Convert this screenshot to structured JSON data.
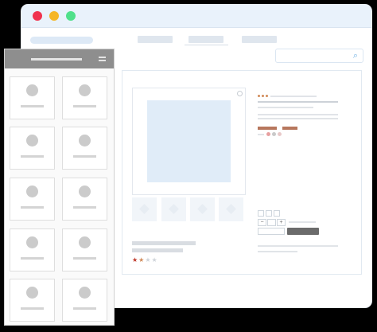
{
  "browser": {
    "traffic_lights": {
      "close": "#f0334f",
      "minimize": "#f5b625",
      "maximize": "#4fe08a"
    },
    "search": {
      "icon": "search-icon"
    },
    "colors": {
      "titlebar": "#e9f2fb",
      "accent": "#b7775d",
      "image": "#e0ecf8"
    }
  },
  "product": {
    "rating": {
      "filled": 2,
      "total": 4
    },
    "swatch_colors": [
      "#e7a0a0",
      "#c9c9c9",
      "#e8c9c9"
    ],
    "thumbnails": 4
  },
  "mobile": {
    "menu_icon": "hamburger-icon",
    "cards": 10
  }
}
